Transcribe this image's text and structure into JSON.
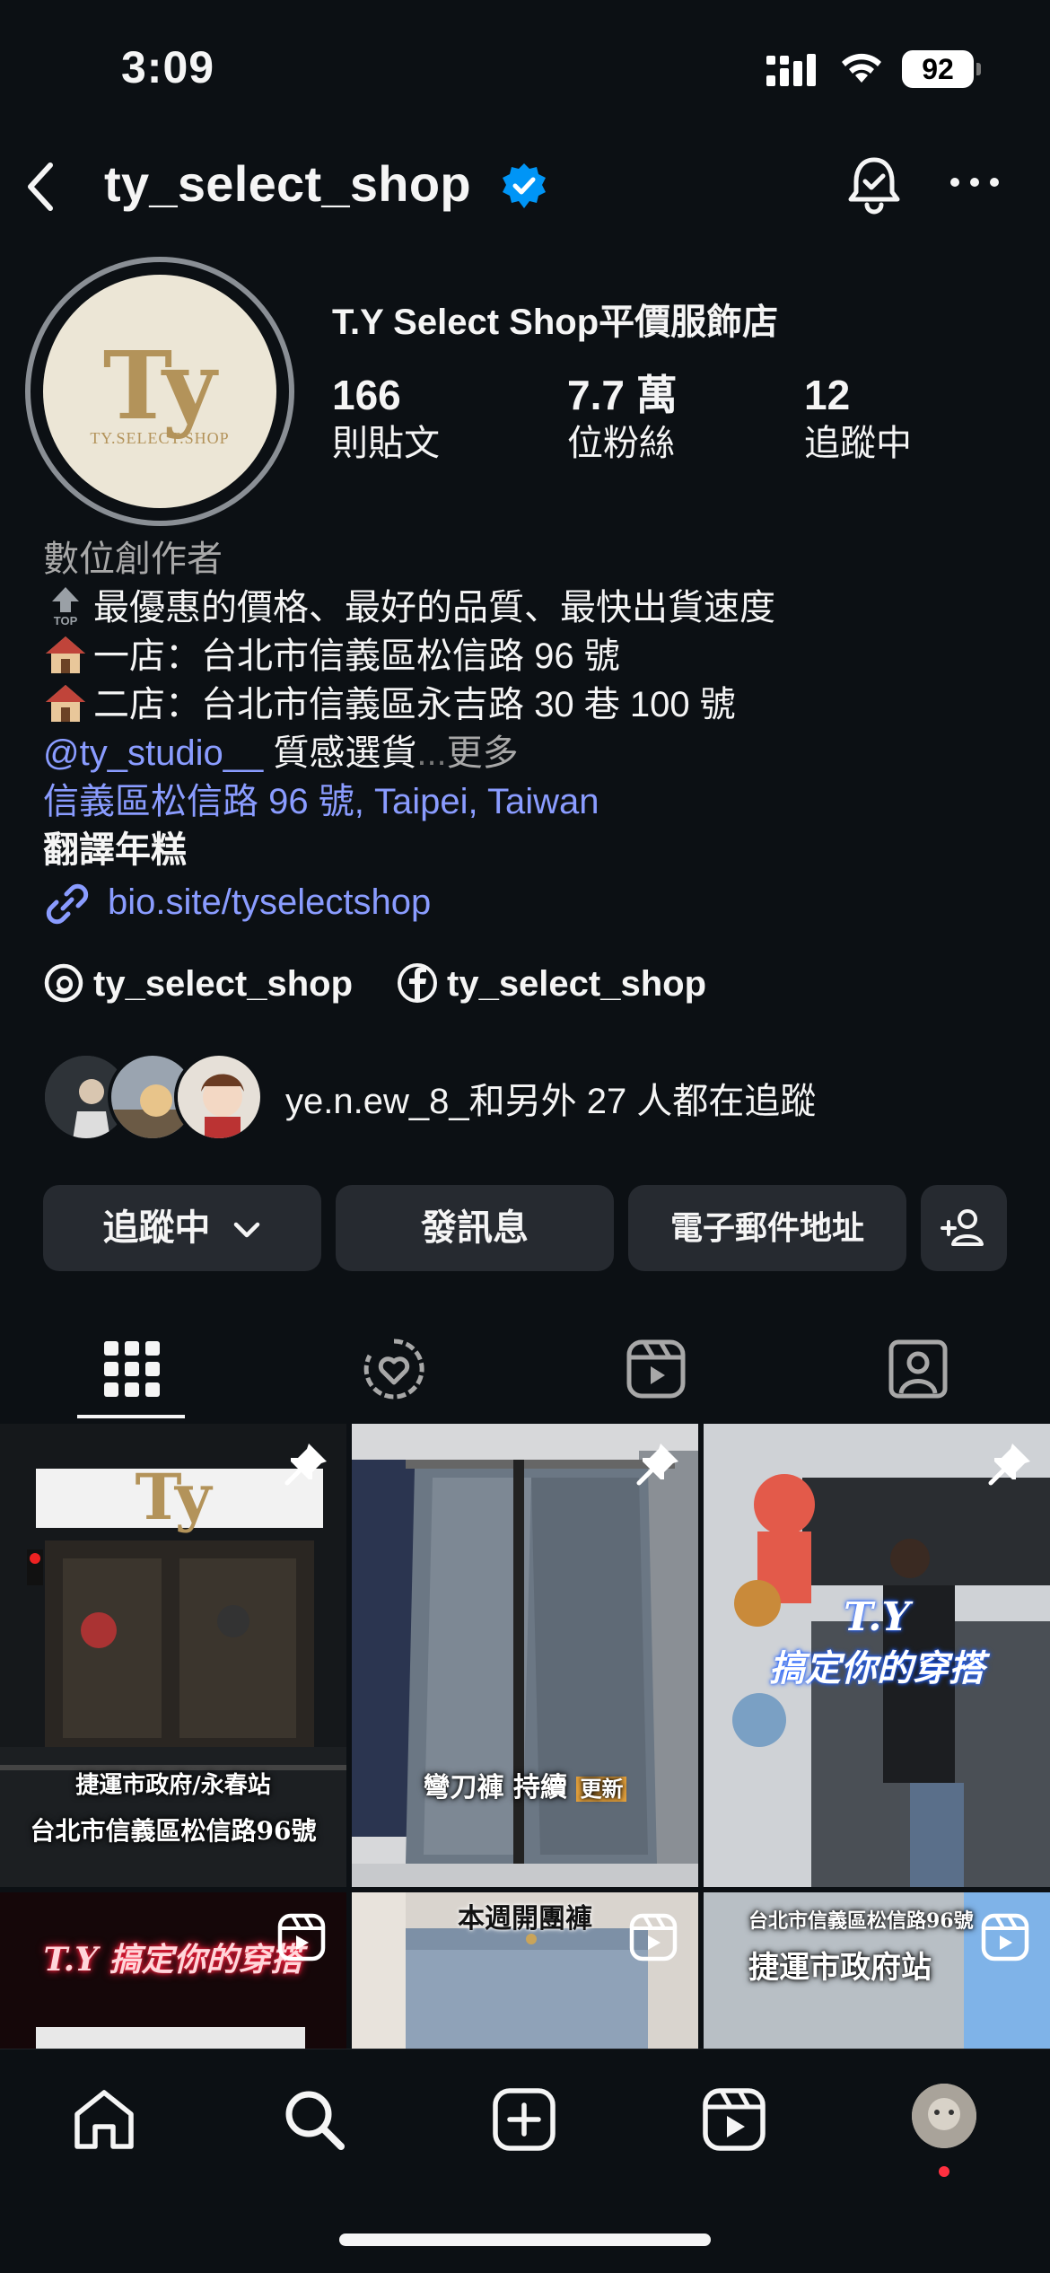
{
  "status_bar": {
    "time": "3:09",
    "battery": "92"
  },
  "header": {
    "username": "ty_select_shop"
  },
  "profile": {
    "avatar_text": "Ty",
    "avatar_sub": "TY.SELECT.SHOP",
    "full_name": "T.Y Select Shop平價服飾店",
    "stats": [
      {
        "num": "166",
        "label": "則貼文"
      },
      {
        "num": "7.7 萬",
        "label": "位粉絲"
      },
      {
        "num": "12",
        "label": "追蹤中"
      }
    ]
  },
  "bio": {
    "category": "數位創作者",
    "line1": "最優惠的價格、最好的品質、最快出貨速度",
    "line2": "一店：台北市信義區松信路 96 號",
    "line3": "二店：台北市信義區永吉路 30 巷 100 號",
    "mention": "@ty_studio__",
    "line4_text": " 質感選貨",
    "ellipsis": "...",
    "more": "更多",
    "location": "信義區松信路 96 號, Taipei, Taiwan",
    "translate": "翻譯年糕",
    "link": "bio.site/tyselectshop"
  },
  "social": {
    "threads": "ty_select_shop",
    "facebook": "ty_select_shop"
  },
  "followed_by": "ye.n.ew_8_和另外 27 人都在追蹤",
  "actions": {
    "following": "追蹤中",
    "message": "發訊息",
    "email": "電子郵件地址"
  },
  "grid": {
    "tile1_caption1": "捷運市政府/永春站",
    "tile1_caption2": "台北市信義區松信路96號",
    "tile1_sign": "Ty",
    "tile2_caption": "彎刀褲 持續",
    "tile2_tag": "更新",
    "tile3_caption1": "T.Y",
    "tile3_caption2": "搞定你的穿搭",
    "tile4_caption": "T.Y 搞定你的穿搭",
    "tile5_caption": "本週開團褲",
    "tile6_caption1": "台北市信義區松信路96號",
    "tile6_caption2": "捷運市政府站"
  },
  "colors": {
    "background": "#0c1014",
    "link": "#8a9cff",
    "verified": "#0095f6",
    "button": "#262a30",
    "notification": "#ff3040"
  }
}
